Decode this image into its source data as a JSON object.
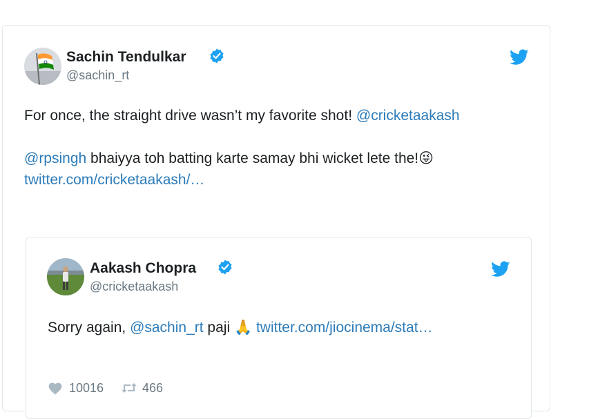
{
  "main_tweet": {
    "display_name": "Sachin Tendulkar",
    "handle": "@sachin_rt",
    "line1_text": "For once, the straight drive wasn’t my favorite shot! ",
    "line1_mention": "@cricketaakash",
    "line2_mention": "@rpsingh",
    "line2_text": " bhaiyya toh batting karte samay bhi wicket lete the!",
    "line2_emoji": "😜",
    "line3_link": "twitter.com/cricketaakash/…"
  },
  "quoted_tweet": {
    "display_name": "Aakash Chopra",
    "handle": "@cricketaakash",
    "text_prefix": "Sorry again, ",
    "mention": "@sachin_rt",
    "text_mid": " paji ",
    "emoji": "🙏",
    "link": "twitter.com/jiocinema/stat…",
    "likes": "10016",
    "retweets": "466"
  },
  "colors": {
    "link": "#2b7bb9",
    "verified": "#1da1f2",
    "twitter_bird": "#1da1f2",
    "muted": "#697882"
  },
  "icons": [
    "verified-badge-icon",
    "twitter-bird-icon",
    "heart-icon",
    "retweet-icon"
  ]
}
